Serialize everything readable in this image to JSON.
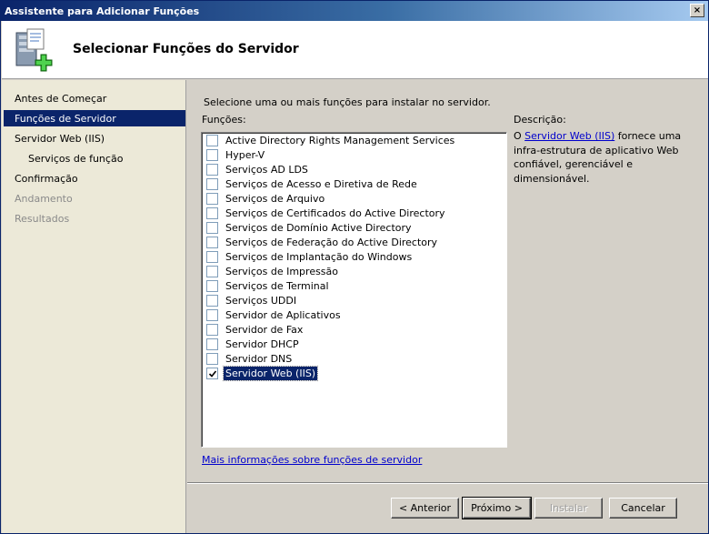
{
  "window": {
    "title": "Assistente para Adicionar Funções",
    "close_glyph": "×"
  },
  "header": {
    "title": "Selecionar Funções do Servidor",
    "icon": "server-roles-add-icon"
  },
  "sidebar": {
    "items": [
      {
        "label": "Antes de Começar",
        "state": "normal"
      },
      {
        "label": "Funções de Servidor",
        "state": "selected"
      },
      {
        "label": "Servidor Web (IIS)",
        "state": "normal"
      },
      {
        "label": "Serviços de função",
        "state": "normal",
        "sub": true
      },
      {
        "label": "Confirmação",
        "state": "normal"
      },
      {
        "label": "Andamento",
        "state": "disabled"
      },
      {
        "label": "Resultados",
        "state": "disabled"
      }
    ]
  },
  "main": {
    "instruction": "Selecione uma ou mais funções para instalar no servidor.",
    "roles_label": "Funções:",
    "description_label": "Descrição:",
    "roles": [
      {
        "label": "Active Directory Rights Management Services",
        "checked": false
      },
      {
        "label": "Hyper-V",
        "checked": false
      },
      {
        "label": "Serviços AD LDS",
        "checked": false
      },
      {
        "label": "Serviços de Acesso e Diretiva de Rede",
        "checked": false
      },
      {
        "label": "Serviços de Arquivo",
        "checked": false
      },
      {
        "label": "Serviços de Certificados do Active Directory",
        "checked": false
      },
      {
        "label": "Serviços de Domínio Active Directory",
        "checked": false
      },
      {
        "label": "Serviços de Federação do Active Directory",
        "checked": false
      },
      {
        "label": "Serviços de Implantação do Windows",
        "checked": false
      },
      {
        "label": "Serviços de Impressão",
        "checked": false
      },
      {
        "label": "Serviços de Terminal",
        "checked": false
      },
      {
        "label": "Serviços UDDI",
        "checked": false
      },
      {
        "label": "Servidor de Aplicativos",
        "checked": false
      },
      {
        "label": "Servidor de Fax",
        "checked": false
      },
      {
        "label": "Servidor DHCP",
        "checked": false
      },
      {
        "label": "Servidor DNS",
        "checked": false
      },
      {
        "label": "Servidor Web (IIS)",
        "checked": true,
        "selected": true
      }
    ],
    "description": {
      "prefix": "O ",
      "link": "Servidor Web (IIS)",
      "suffix": " fornece uma infra-estrutura de aplicativo Web confiável, gerenciável e dimensionável."
    },
    "more_info_link": "Mais informações sobre funções de servidor"
  },
  "footer": {
    "back": "< Anterior",
    "next": "Próximo >",
    "install": "Instalar",
    "cancel": "Cancelar"
  },
  "colors": {
    "selection": "#0a246a",
    "link": "#0000cc",
    "sidebar_bg": "#ece9d8",
    "dialog_bg": "#d4d0c8"
  }
}
